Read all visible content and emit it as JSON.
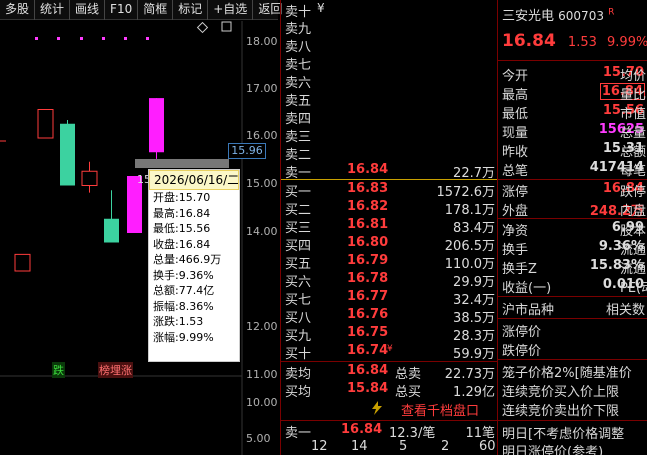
{
  "toolbar": [
    "多股",
    "统计",
    "画线",
    "F10",
    "简框",
    "标记",
    "+自选",
    "返回"
  ],
  "chart": {
    "price_labels": [
      "18.00",
      "17.00",
      "16.00",
      "15.00",
      "14.00",
      "12.00",
      "11.00",
      "10.00",
      "5.00"
    ],
    "current_price": "15.96",
    "cursor_price_fragment": "15",
    "tag_down": "跌",
    "tag_hot": "榜埋涨",
    "candles": [
      {
        "open": 13.55,
        "close": 13.2,
        "high": 13.55,
        "low": 13.2,
        "color": "hollow"
      },
      {
        "open": 16.6,
        "close": 16.0,
        "high": 16.6,
        "low": 16.0,
        "color": "hollow"
      },
      {
        "open": 16.3,
        "close": 15.0,
        "high": 16.38,
        "low": 15.0,
        "color": "green"
      },
      {
        "open": 15.3,
        "close": 15.0,
        "high": 15.5,
        "low": 14.85,
        "color": "hollow"
      },
      {
        "open": 14.3,
        "close": 13.8,
        "high": 14.9,
        "low": 13.8,
        "color": "green"
      },
      {
        "open": 14.0,
        "close": 15.2,
        "high": 15.2,
        "low": 14.0,
        "color": "magenta"
      },
      {
        "open": 15.7,
        "close": 16.84,
        "high": 16.84,
        "low": 15.56,
        "color": "magenta"
      }
    ]
  },
  "tooltip": {
    "date": "2026/06/16/二",
    "rows": [
      "开盘:15.70",
      "最高:16.84",
      "最低:15.56",
      "收盘:16.84",
      "总量:466.9万",
      "换手:9.36%",
      "总额:77.4亿",
      "振幅:8.36%",
      "涨跌:1.53",
      "涨幅:9.99%"
    ]
  },
  "book": {
    "asks": [
      "卖十",
      "卖九",
      "卖八",
      "卖七",
      "卖六",
      "卖五",
      "卖四",
      "卖三",
      "卖二"
    ],
    "ask_top_suffix": "¥",
    "ask1": {
      "label": "卖一",
      "price": "16.84",
      "vol": "22.7万"
    },
    "bids": [
      {
        "label": "买一",
        "price": "16.83",
        "vol": "1572.6万"
      },
      {
        "label": "买二",
        "price": "16.82",
        "vol": "178.1万"
      },
      {
        "label": "买三",
        "price": "16.81",
        "vol": "83.4万"
      },
      {
        "label": "买四",
        "price": "16.80",
        "vol": "206.5万"
      },
      {
        "label": "买五",
        "price": "16.79",
        "vol": "110.0万"
      },
      {
        "label": "买六",
        "price": "16.78",
        "vol": "29.9万"
      },
      {
        "label": "买七",
        "price": "16.77",
        "vol": "32.4万"
      },
      {
        "label": "买八",
        "price": "16.76",
        "vol": "38.5万"
      },
      {
        "label": "买九",
        "price": "16.75",
        "vol": "28.3万"
      },
      {
        "label": "买十",
        "price": "16.74",
        "vol": "59.9万"
      }
    ],
    "bid10_mark": "¥",
    "sell_avg": {
      "label": "卖均",
      "price": "16.84",
      "k": "总卖",
      "v": "22.73万"
    },
    "buy_avg": {
      "label": "买均",
      "price": "15.84",
      "k": "总买",
      "v": "1.29亿"
    },
    "view_level": "查看千档盘口",
    "trade": {
      "label": "卖一",
      "price": "16.84",
      "detail": "12.3/笔",
      "count": "11笔"
    },
    "bottom_nums": [
      "12",
      "14",
      "5",
      "2",
      "60"
    ]
  },
  "quote": {
    "name": "三安光电",
    "code": "600703",
    "badge": "R",
    "price": "16.84",
    "change": "1.53",
    "pct": "9.99%",
    "rows1": [
      {
        "k": "今开",
        "v": "15.70",
        "c": "#ff3c3c",
        "k2": "均价"
      },
      {
        "k": "最高",
        "v": "16.84",
        "c": "#ff3c3c",
        "k2": "量比",
        "box": true
      },
      {
        "k": "最低",
        "v": "15.56",
        "c": "#ff3c3c",
        "k2": "市值"
      },
      {
        "k": "现量",
        "v": "15625",
        "c": "#ff3cff",
        "k2": "总量"
      },
      {
        "k": "昨收",
        "v": "15.31",
        "c": "#dddddd",
        "k2": "总额"
      },
      {
        "k": "总笔",
        "v": "417414",
        "c": "#dddddd",
        "k2": "每笔"
      }
    ],
    "rows2": [
      {
        "k": "涨停",
        "v": "16.84",
        "c": "#ff3c3c",
        "k2": "跌停"
      },
      {
        "k": "外盘",
        "v": "248.2万",
        "c": "#ff3c3c",
        "k2": "内盘"
      }
    ],
    "rows3": [
      {
        "k": "净资",
        "v": "6.99",
        "c": "#dddddd",
        "k2": "股本"
      },
      {
        "k": "换手",
        "v": "9.36%",
        "c": "#dddddd",
        "k2": "流通"
      },
      {
        "k": "换手Z",
        "v": "15.83%",
        "c": "#dddddd",
        "k2": "流通"
      },
      {
        "k": "收益(一)",
        "v": "0.010",
        "c": "#dddddd",
        "k2": "PE(动"
      }
    ],
    "market_row": {
      "k": "沪市品种",
      "k2": "相关数"
    },
    "limit_up": "涨停价",
    "limit_down": "跌停价",
    "cage": "笼子价格2%[随基准价",
    "call_buy": "连续竞价买入价上限",
    "call_sell": "连续竞价卖出价下限",
    "tomorrow1": "明日[不考虑价格调整",
    "tomorrow2": "明日涨停价(参考)"
  }
}
